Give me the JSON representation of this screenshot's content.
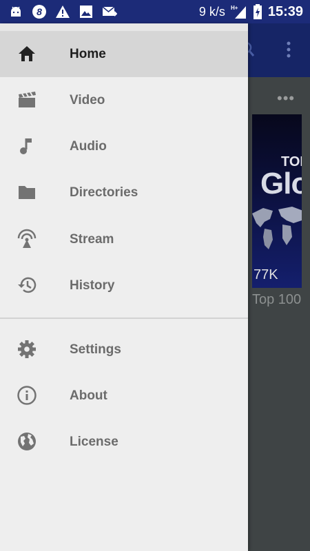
{
  "status_bar": {
    "network_speed": "9 k/s",
    "network_type": "H+",
    "time": "15:39",
    "icons": [
      "android-icon",
      "sync-badge-icon",
      "warning-icon",
      "image-icon",
      "mail-icon",
      "signal-icon",
      "battery-charging-icon"
    ]
  },
  "drawer": {
    "primary_items": [
      {
        "label": "Home",
        "icon": "home-icon",
        "selected": true
      },
      {
        "label": "Video",
        "icon": "video-clapper-icon",
        "selected": false
      },
      {
        "label": "Audio",
        "icon": "music-note-icon",
        "selected": false
      },
      {
        "label": "Directories",
        "icon": "folder-icon",
        "selected": false
      },
      {
        "label": "Stream",
        "icon": "antenna-icon",
        "selected": false
      },
      {
        "label": "History",
        "icon": "history-icon",
        "selected": false
      }
    ],
    "secondary_items": [
      {
        "label": "Settings",
        "icon": "gear-icon"
      },
      {
        "label": "About",
        "icon": "info-icon"
      },
      {
        "label": "License",
        "icon": "globe-icon"
      }
    ]
  },
  "background_app": {
    "card_dots": "•••",
    "thumbnail_text_top": "TOP",
    "thumbnail_text_main": "Glo",
    "thumbnail_views": "77K",
    "card_title": "Top 100"
  },
  "colors": {
    "status_bar": "#1c2b78",
    "app_toolbar": "#162566",
    "drawer_bg": "#eeeeee",
    "selected_bg": "#d6d6d6",
    "scrim": "#424748"
  }
}
